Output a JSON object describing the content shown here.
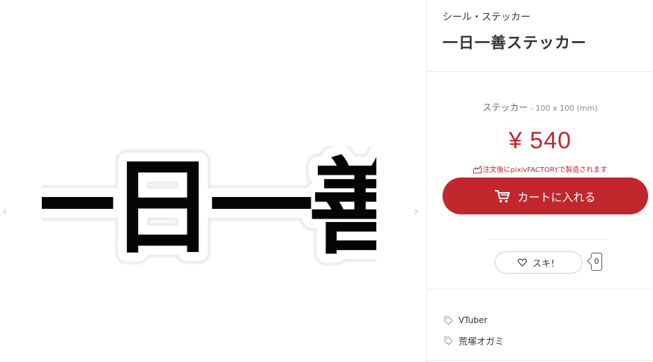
{
  "product": {
    "category": "シール・ステッカー",
    "title": "一日一善ステッカー",
    "sticker_text": "一日一善"
  },
  "variant": {
    "name": "ステッカー",
    "size": " - 100 x 100 (mm)"
  },
  "price": "¥ 540",
  "factory_note": "注文後にpixivFACTORYで製造されます",
  "cart_button": {
    "label": "カートに入れる"
  },
  "like": {
    "label": "スキ！",
    "count": "0"
  },
  "tags": [
    "VTuber",
    "荒塚オガミ"
  ],
  "icons": {
    "prev": "chevron-left-icon",
    "next": "chevron-right-icon",
    "cart": "cart-icon",
    "heart": "heart-icon",
    "tag": "tag-icon",
    "factory": "factory-icon"
  },
  "colors": {
    "accent": "#c1272d",
    "border": "#ececec"
  }
}
